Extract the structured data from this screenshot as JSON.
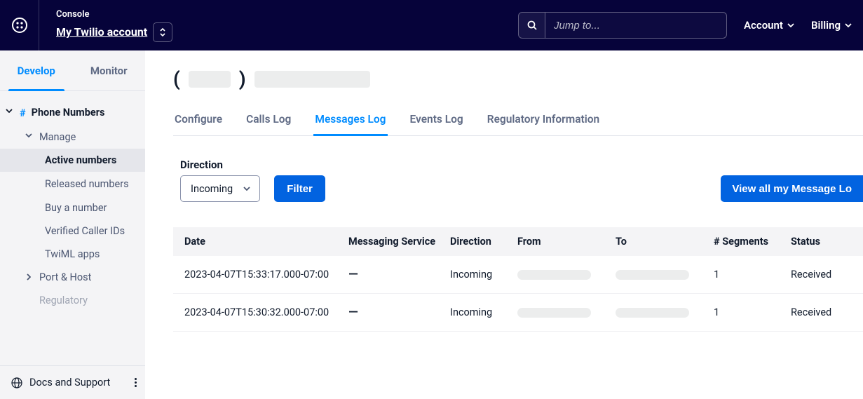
{
  "header": {
    "console_label": "Console",
    "account_name": "My Twilio account",
    "search_placeholder": "Jump to...",
    "account_link": "Account",
    "billing_link": "Billing"
  },
  "sidebar_tabs": {
    "develop": "Develop",
    "monitor": "Monitor"
  },
  "nav": {
    "phone_numbers": "Phone Numbers",
    "manage": "Manage",
    "active_numbers": "Active numbers",
    "released_numbers": "Released numbers",
    "buy_a_number": "Buy a number",
    "verified_caller_ids": "Verified Caller IDs",
    "twiml_apps": "TwiML apps",
    "port_host": "Port & Host",
    "regulatory": "Regulatory"
  },
  "sidebar_footer": {
    "docs": "Docs and Support"
  },
  "content_tabs": {
    "configure": "Configure",
    "calls_log": "Calls Log",
    "messages_log": "Messages Log",
    "events_log": "Events Log",
    "regulatory_info": "Regulatory Information"
  },
  "filter": {
    "direction_label": "Direction",
    "direction_value": "Incoming",
    "filter_button": "Filter",
    "view_all_button": "View all my Message Lo"
  },
  "table": {
    "headers": {
      "date": "Date",
      "messaging_service": "Messaging Service",
      "direction": "Direction",
      "from": "From",
      "to": "To",
      "segments": "# Segments",
      "status": "Status"
    },
    "rows": [
      {
        "date": "2023-04-07T15:33:17.000-07:00",
        "messaging_service": "—",
        "direction": "Incoming",
        "segments": "1",
        "status": "Received"
      },
      {
        "date": "2023-04-07T15:30:32.000-07:00",
        "messaging_service": "—",
        "direction": "Incoming",
        "segments": "1",
        "status": "Received"
      }
    ]
  }
}
